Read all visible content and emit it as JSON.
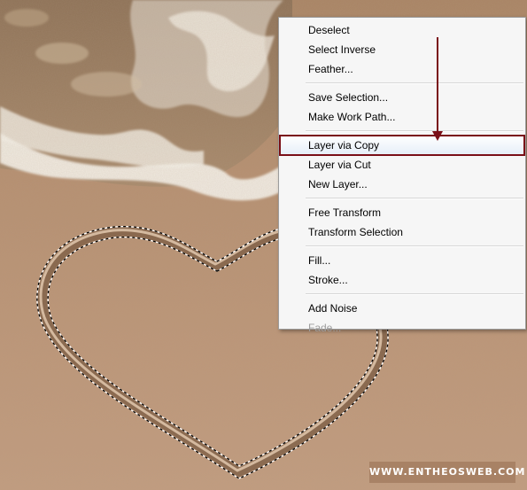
{
  "context_menu": {
    "groups": [
      [
        {
          "label": "Deselect",
          "enabled": true
        },
        {
          "label": "Select Inverse",
          "enabled": true
        },
        {
          "label": "Feather...",
          "enabled": true
        }
      ],
      [
        {
          "label": "Save Selection...",
          "enabled": true
        },
        {
          "label": "Make Work Path...",
          "enabled": true
        }
      ],
      [
        {
          "label": "Layer via Copy",
          "enabled": true,
          "highlighted": true
        },
        {
          "label": "Layer via Cut",
          "enabled": true
        },
        {
          "label": "New Layer...",
          "enabled": true
        }
      ],
      [
        {
          "label": "Free Transform",
          "enabled": true
        },
        {
          "label": "Transform Selection",
          "enabled": true
        }
      ],
      [
        {
          "label": "Fill...",
          "enabled": true
        },
        {
          "label": "Stroke...",
          "enabled": true
        }
      ],
      [
        {
          "label": "Add Noise",
          "enabled": true
        },
        {
          "label": "Fade...",
          "enabled": false
        }
      ]
    ]
  },
  "watermark": {
    "text": "WWW.ENTHEOSWEB.COM"
  },
  "colors": {
    "sand": "#b68f70",
    "foam": "#f4f1ea",
    "highlight_border": "#7a0f17",
    "arrow": "#7a0f17"
  }
}
